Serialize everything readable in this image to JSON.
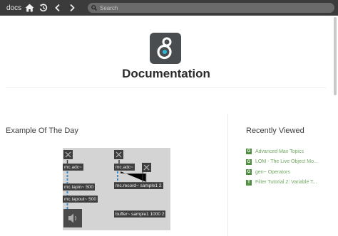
{
  "toolbar": {
    "title": "docs",
    "home_icon": "home-icon",
    "history_icon": "history-icon",
    "back_icon": "chevron-left-icon",
    "forward_icon": "chevron-right-icon"
  },
  "search": {
    "placeholder": "Search",
    "value": ""
  },
  "hero": {
    "title": "Documentation",
    "logo_icon": "max-logo-icon"
  },
  "example": {
    "title": "Example Of The Day",
    "patch": {
      "objects": [
        "mc.adc~",
        "mc.tapin~ 500",
        "mc.tapout~ 500",
        "mc.adc~",
        "mc.record~ sample1 2",
        "buffer~ sample1 1000 2"
      ]
    }
  },
  "recent": {
    "title": "Recently Viewed",
    "items": [
      {
        "badge": "G",
        "label": "Advanced Max Topics"
      },
      {
        "badge": "G",
        "label": "LOM - The Live Object Mo..."
      },
      {
        "badge": "G",
        "label": "gen~ Operators"
      },
      {
        "badge": "T",
        "label": "Filter Tutorial 2: Variable T..."
      }
    ]
  },
  "colors": {
    "toolbar": "#3b3b3b",
    "link": "#6fa85f",
    "badge": "#4f8f3f"
  }
}
